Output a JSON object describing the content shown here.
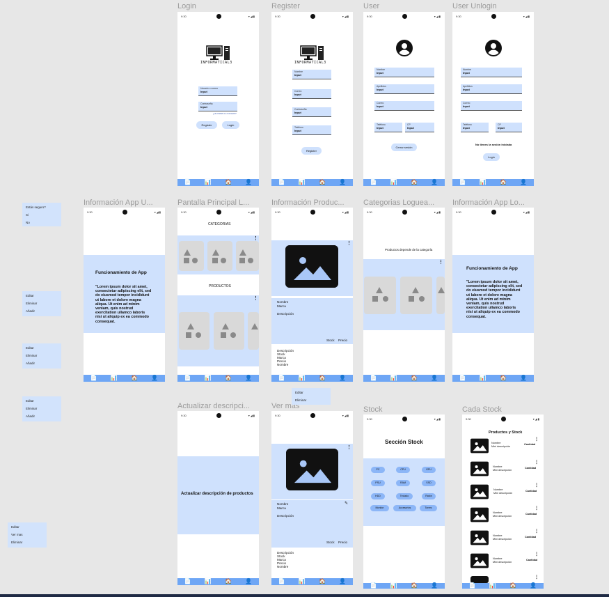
{
  "frames": {
    "login": "Login",
    "register": "Register",
    "user": "User",
    "user_unlogin": "User Unlogin",
    "info_app_u": "Información App U...",
    "pantalla_principal": "Pantalla Principal L...",
    "info_producto": "Información Produc...",
    "categorias": "Categorias Loguea...",
    "info_app_lo": "Información App Lo...",
    "actualizar": "Actualizar descripci...",
    "ver_mas": "Ver mas",
    "stock": "Stock",
    "cada_stock": "Cada Stock"
  },
  "status": {
    "time": "9:30",
    "icons": "▾◢▮"
  },
  "nav_icons": [
    "📄",
    "📊",
    "🏠",
    "👤"
  ],
  "brand": "INFORMATICAL3",
  "login": {
    "email_label": "Usuario o correo",
    "email_value": "Input",
    "pass_label": "Contraseña",
    "pass_value": "Input",
    "forgot": "¿Ha olvidado su contraseña?",
    "register_btn": "Register",
    "login_btn": "Login"
  },
  "register": {
    "fields": [
      {
        "label": "Nombre",
        "value": "Input"
      },
      {
        "label": "Correo",
        "value": "Input"
      },
      {
        "label": "Contraseña",
        "value": "Input"
      },
      {
        "label": "Teléfono",
        "value": "Input"
      }
    ],
    "btn": "Register"
  },
  "user": {
    "nombre_l": "Nombre",
    "nombre_v": "Input",
    "apellidos_l": "Apellidos",
    "apellidos_v": "Input",
    "correo_l": "Correo",
    "correo_v": "Input",
    "tel_l": "Teléfono",
    "tel_v": "Input",
    "cp_l": "CP",
    "cp_v": "Input",
    "logout": "Cerrar sesión"
  },
  "user_unlogin": {
    "nombre_l": "Nombre",
    "nombre_v": "Input",
    "apellidos_l": "Apellidos",
    "apellidos_v": "Input",
    "correo_l": "Correo",
    "correo_v": "Input",
    "tel_l": "Teléfono",
    "tel_v": "Input",
    "cp_l": "CP",
    "cp_v": "Input",
    "notice": "No tienes la sesión iniciada",
    "login_btn": "Login"
  },
  "stickies": {
    "confirm": [
      "Estás seguro?",
      "Si",
      "No"
    ],
    "menu1": [
      "Editar",
      "Eliminar",
      "Añadir"
    ],
    "menu2": [
      "Editar",
      "Eliminar",
      "Añadir"
    ],
    "menu3": [
      "Editar",
      "Eliminar",
      "Añadir"
    ],
    "menu4": [
      "Editar",
      "Ver mas",
      "Eliminar"
    ],
    "menu5": [
      "Editar",
      "Eliminar"
    ]
  },
  "info_app": {
    "heading": "Funcionamiento de App",
    "body": "\"Lorem ipsum dolor sit amet, consectetur adipiscing elit, sed do eiusmod tempor incididunt ut labore et dolore magna aliqua. Ut enim ad minim veniam, quis nostrud exercitation ullamco laboris nisi ut aliquip ex ea commodo consequat."
  },
  "principal": {
    "categorias": "CATEGORIAS",
    "productos": "PRODUCTOS"
  },
  "producto": {
    "nombre": "Nombre",
    "marca": "Marca",
    "descripcion": "Descripción",
    "stock": "Stock",
    "precio": "Precio",
    "list": [
      "Descripción",
      "Stock",
      "Marca",
      "Precio",
      "Nombre"
    ]
  },
  "categorias_text": "Productos depende de la categoría",
  "actualizar_text": "Actualizar descripción de productos",
  "stock_section": {
    "title": "Sección Stock",
    "chips": [
      "PC",
      "CPU",
      "GPU",
      "PSU",
      "RAM",
      "SSD",
      "HDD",
      "Teclado",
      "Ratón",
      "Monitor",
      "Accesorios",
      "Torres"
    ]
  },
  "cada_stock": {
    "title": "Productos y Stock",
    "name": "Nombre",
    "desc": "Mini descripción",
    "qty": "Cantidad"
  }
}
